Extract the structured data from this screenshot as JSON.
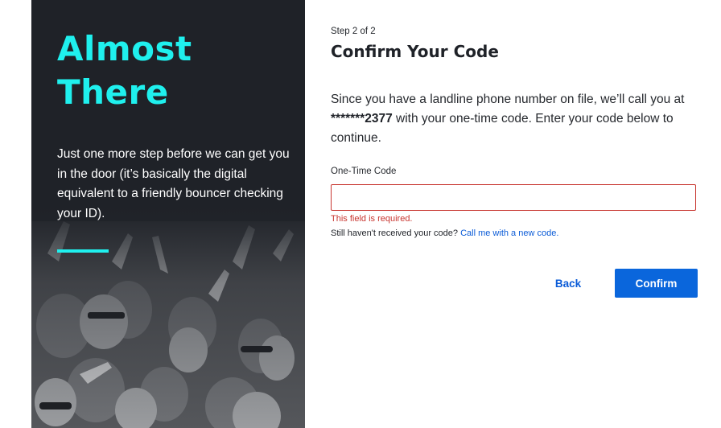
{
  "hero": {
    "headline_line1": "Almost",
    "headline_line2": "There",
    "intro": "Just one more step before we can get you in the door (it’s basically the digital equivalent to a friendly bouncer checking your ID)."
  },
  "form": {
    "step": "Step 2 of 2",
    "title": "Confirm Your Code",
    "description_before": "Since you have a landline phone number on file, we’ll call you at ",
    "masked_phone": "*******2377",
    "description_after": " with your one-time code. Enter your code below to continue.",
    "code_label": "One-Time Code",
    "code_value": "",
    "error_text": "This field is required.",
    "resend_prompt": "Still haven't received your code? ",
    "resend_link": "Call me with a new code.",
    "back_label": "Back",
    "confirm_label": "Confirm"
  },
  "colors": {
    "accent": "#1ff0ee",
    "panel_bg": "#1f2228",
    "primary": "#0a66dc",
    "error": "#c8352f",
    "link": "#0a5bd7"
  }
}
